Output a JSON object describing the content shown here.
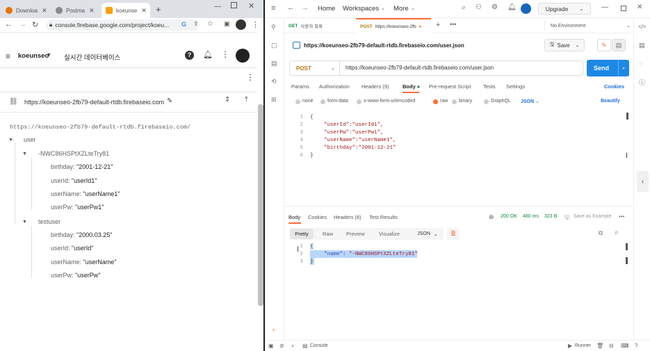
{
  "chrome": {
    "tabs": [
      {
        "label": "Downloa",
        "active": false,
        "color": "#e8710a"
      },
      {
        "label": "Postma",
        "active": false,
        "color": "#666666"
      },
      {
        "label": "koeunse",
        "active": true,
        "color": "#ffa000"
      }
    ],
    "url": "console.firebase.google.com/project/koeu..."
  },
  "firebase": {
    "project": "koeunseo",
    "section": "실시간 데이터베이스",
    "db_url": "https://koeunseo-2fb79-default-rtdb.firebaseio.com",
    "root_url": "https://koeunseo-2fb79-default-rtdb.firebaseio.com/",
    "root_node": "user",
    "push_key": "-NWC86HSPtXZLteTry81",
    "push_fields": [
      {
        "key": "birthday:",
        "value": "\"2001-12-21\""
      },
      {
        "key": "userId:",
        "value": "\"userId1\""
      },
      {
        "key": "userName:",
        "value": "\"userName1\""
      },
      {
        "key": "userPw:",
        "value": "\"userPw1\""
      }
    ],
    "test_key": "testuser",
    "test_fields": [
      {
        "key": "birthday:",
        "value": "\"2000.03.25\""
      },
      {
        "key": "userId:",
        "value": "\"userId\""
      },
      {
        "key": "userName:",
        "value": "\"userName\""
      },
      {
        "key": "userPw:",
        "value": "\"userPw\""
      }
    ]
  },
  "postman": {
    "nav": {
      "home": "Home",
      "workspaces": "Workspaces",
      "more": "More",
      "upgrade": "Upgrade"
    },
    "tabs": [
      {
        "method": "GET",
        "label": "사용자 목록"
      },
      {
        "method": "POST",
        "label": "https://koeunseo-2fb"
      }
    ],
    "environment": "No Environment",
    "request_title": "https://koeunseo-2fb79-default-rtdb.firebaseio.com/user.json",
    "save": "Save",
    "method": "POST",
    "url": "https://koeunseo-2fb79-default-rtdb.firebaseio.com/user.json",
    "send": "Send",
    "req_tabs": {
      "params": "Params",
      "auth": "Authorization",
      "headers": "Headers (9)",
      "body": "Body",
      "prereq": "Pre-request Script",
      "tests": "Tests",
      "settings": "Settings",
      "cookies": "Cookies"
    },
    "body_types": {
      "none": "none",
      "form": "form-data",
      "urlenc": "x-www-form-urlencoded",
      "raw": "raw",
      "binary": "binary",
      "graphql": "GraphQL",
      "json": "JSON",
      "beautify": "Beautify"
    },
    "request_body": [
      {
        "n": "1",
        "text": "{"
      },
      {
        "n": "2",
        "key": "\"userId\"",
        "value": "\"userId1\","
      },
      {
        "n": "3",
        "key": "\"userPw\"",
        "value": "\"userPw1\","
      },
      {
        "n": "4",
        "key": "\"userName\"",
        "value": "\"userName1\","
      },
      {
        "n": "5",
        "key": "\"birthday\"",
        "value": "\"2001-12-21\""
      },
      {
        "n": "6",
        "text": "}"
      }
    ],
    "resp_tabs": {
      "body": "Body",
      "cookies": "Cookies",
      "headers": "Headers (8)",
      "results": "Test Results"
    },
    "status": {
      "code": "200 OK",
      "time": "480 ms",
      "size": "323 B",
      "save_example": "Save as Example"
    },
    "view_tabs": {
      "pretty": "Pretty",
      "raw": "Raw",
      "preview": "Preview",
      "visualize": "Visualize",
      "format": "JSON"
    },
    "response_body": [
      {
        "n": "1",
        "text": "{"
      },
      {
        "n": "2",
        "key": "\"name\"",
        "value": "\"-NWC86HSPtXZLteTry81\""
      },
      {
        "n": "3",
        "text": "}"
      }
    ],
    "footer": {
      "console": "Console",
      "runner": "Runner"
    }
  }
}
